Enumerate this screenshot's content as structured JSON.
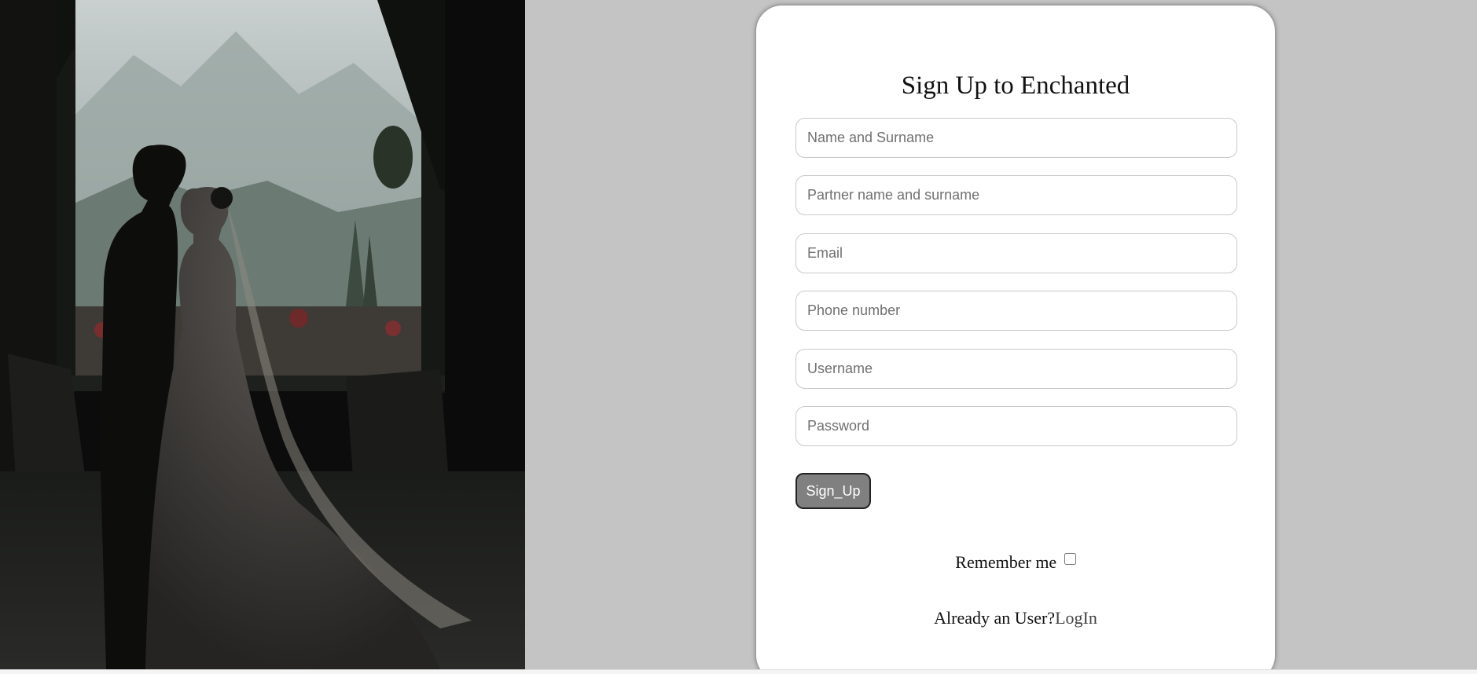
{
  "form": {
    "title": "Sign Up to Enchanted",
    "fields": {
      "name_placeholder": "Name and Surname",
      "partner_placeholder": "Partner name and surname",
      "email_placeholder": "Email",
      "phone_placeholder": "Phone number",
      "username_placeholder": "Username",
      "password_placeholder": "Password"
    },
    "submit_label": "Sign_Up",
    "remember_label": "Remember me",
    "already_text": "Already an User?",
    "login_link": "LogIn"
  },
  "colors": {
    "page_background": "#c4c4c4",
    "card_background": "#ffffff",
    "button_background": "#808080"
  }
}
